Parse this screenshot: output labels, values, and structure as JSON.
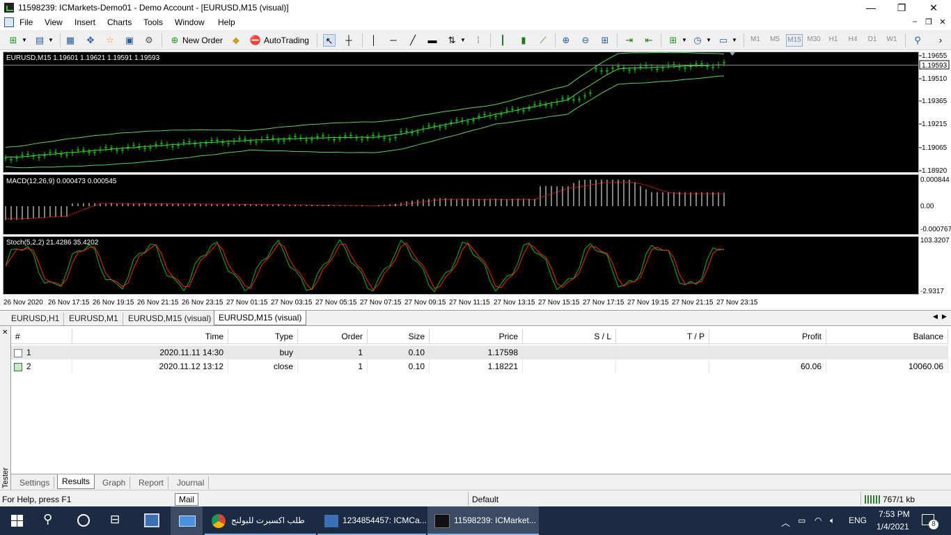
{
  "window": {
    "title": "11598239: ICMarkets-Demo01 - Demo Account - [EURUSD,M15 (visual)]",
    "min": "—",
    "max": "❐",
    "close": "✕"
  },
  "menu": {
    "items": [
      "File",
      "View",
      "Insert",
      "Charts",
      "Tools",
      "Window",
      "Help"
    ],
    "right_buttons": [
      "–",
      "❐",
      "✕"
    ]
  },
  "toolbar": {
    "new_order": "New Order",
    "autotrading": "AutoTrading",
    "timeframes": [
      "M1",
      "M5",
      "M15",
      "M30",
      "H1",
      "H4",
      "D1",
      "W1"
    ],
    "active_timeframe": "M15"
  },
  "chart": {
    "price_header": "EURUSD,M15  1.19601 1.19621 1.19591 1.19593",
    "price_labels": [
      "1.19655",
      "1.19510",
      "1.19365",
      "1.19215",
      "1.19065",
      "1.18920"
    ],
    "current_price": "1.19593",
    "macd_header": "MACD(12,26,9) 0.000473 0.000545",
    "macd_labels": [
      "0.000844",
      "0.00",
      "-0.000767"
    ],
    "stoch_header": "Stoch(5,2,2) 21.4286 35.4202",
    "stoch_labels": [
      "103.3207",
      "-2.9317"
    ],
    "time_labels": [
      "26 Nov 2020",
      "26 Nov 17:15",
      "26 Nov 19:15",
      "26 Nov 21:15",
      "26 Nov 23:15",
      "27 Nov 01:15",
      "27 Nov 03:15",
      "27 Nov 05:15",
      "27 Nov 07:15",
      "27 Nov 09:15",
      "27 Nov 11:15",
      "27 Nov 13:15",
      "27 Nov 15:15",
      "27 Nov 17:15",
      "27 Nov 19:15",
      "27 Nov 21:15",
      "27 Nov 23:15"
    ],
    "colors": {
      "bg": "#000000",
      "candle": "#00e000",
      "band": "#5fd35f",
      "macd_hist": "#ffffff",
      "macd_signal": "#ff2020",
      "stoch_main": "#00c000",
      "stoch_signal": "#ff2020"
    }
  },
  "chart_tabs": [
    "EURUSD,H1",
    "EURUSD,M1",
    "EURUSD,M15 (visual)",
    "EURUSD,M15 (visual)"
  ],
  "active_chart_tab": 3,
  "tester": {
    "side_label": "Tester",
    "columns": [
      "#",
      "Time",
      "Type",
      "Order",
      "Size",
      "Price",
      "S / L",
      "T / P",
      "Profit",
      "Balance"
    ],
    "rows": [
      {
        "num": "1",
        "time": "2020.11.11 14:30",
        "type": "buy",
        "order": "1",
        "size": "0.10",
        "price": "1.17598",
        "sl": "",
        "tp": "",
        "profit": "",
        "balance": ""
      },
      {
        "num": "2",
        "time": "2020.11.12 13:12",
        "type": "close",
        "order": "1",
        "size": "0.10",
        "price": "1.18221",
        "sl": "",
        "tp": "",
        "profit": "60.06",
        "balance": "10060.06"
      }
    ],
    "tabs": [
      "Settings",
      "Results",
      "Graph",
      "Report",
      "Journal"
    ],
    "active_tab": 1
  },
  "status": {
    "help": "For Help, press F1",
    "profile": "Default",
    "traffic": "767/1 kb"
  },
  "tooltip": "Mail",
  "taskbar": {
    "items": [
      {
        "label": "طلب اكسبرت للبولنج"
      },
      {
        "label": "1234854457: ICMCa..."
      },
      {
        "label": "11598239: ICMarket..."
      }
    ],
    "lang": "ENG",
    "time": "7:53 PM",
    "date": "1/4/2021",
    "notifications": "8"
  }
}
